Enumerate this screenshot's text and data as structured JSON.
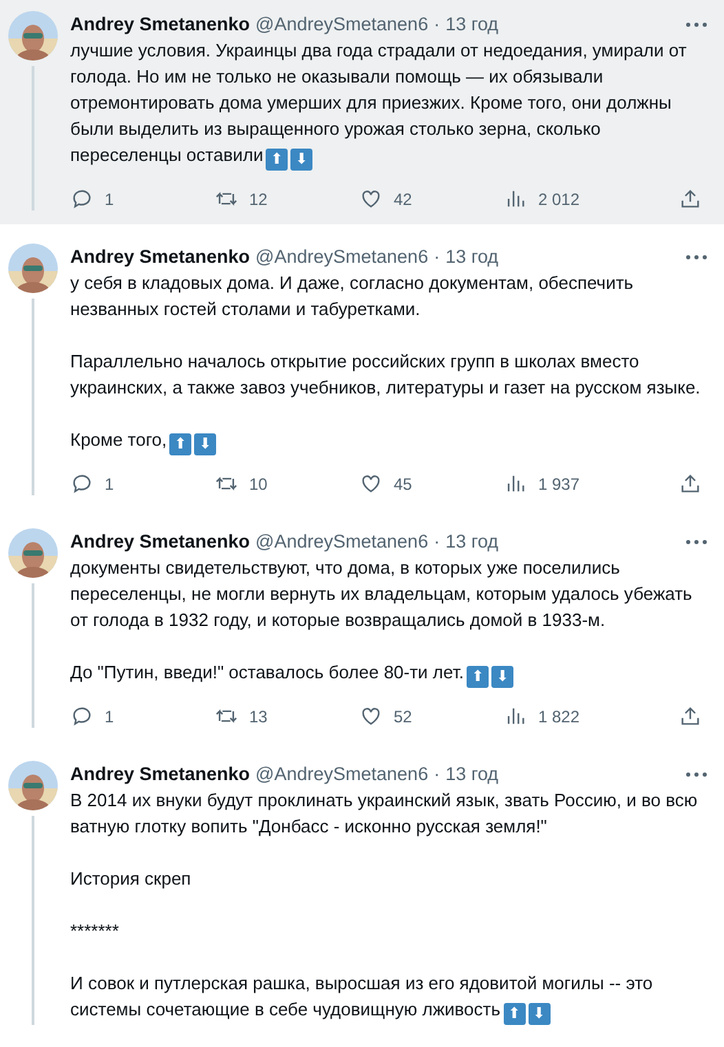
{
  "tweets": [
    {
      "author": "Andrey Smetanenko",
      "handle": "@AndreySmetanen6",
      "separator": "·",
      "time": "13 год",
      "highlighted": true,
      "paragraphs": [
        "лучшие условия. Украинцы два года страдали от недоедания, умирали от голода. Но им не только не оказывали помощь — их обязывали отремонтировать дома умерших для приезжих. Кроме того, они должны были выделить из выращенного урожая столько зерна, сколько переселенцы оставили"
      ],
      "emoji": [
        "⬆",
        "⬇"
      ],
      "replies": "1",
      "retweets": "12",
      "likes": "42",
      "views": "2 012"
    },
    {
      "author": "Andrey Smetanenko",
      "handle": "@AndreySmetanen6",
      "separator": "·",
      "time": "13 год",
      "highlighted": false,
      "paragraphs": [
        "у себя в кладовых дома. И даже, согласно документам, обеспечить незванных гостей столами и табуретками.",
        "Параллельно началось открытие российских групп в школах вместо украинских, а также завоз учебников, литературы и газет на русском языке.",
        "Кроме того,"
      ],
      "emoji": [
        "⬆",
        "⬇"
      ],
      "replies": "1",
      "retweets": "10",
      "likes": "45",
      "views": "1 937"
    },
    {
      "author": "Andrey Smetanenko",
      "handle": "@AndreySmetanen6",
      "separator": "·",
      "time": "13 год",
      "highlighted": false,
      "paragraphs": [
        "документы свидетельствуют, что дома, в которых уже поселились переселенцы, не могли вернуть их владельцам, которым удалось убежать от голода в 1932 году, и которые возвращались домой в 1933-м.",
        "До \"Путин, введи!\" оставалось более 80-ти лет."
      ],
      "emoji": [
        "⬆",
        "⬇"
      ],
      "replies": "1",
      "retweets": "13",
      "likes": "52",
      "views": "1 822"
    },
    {
      "author": "Andrey Smetanenko",
      "handle": "@AndreySmetanen6",
      "separator": "·",
      "time": "13 год",
      "highlighted": false,
      "paragraphs": [
        "В 2014 их внуки будут проклинать украинский язык, звать Россию, и во всю ватную глотку вопить \"Донбасс - исконно русская земля!\"",
        "История скреп",
        "*******",
        "И совок и путлерская рашка, выросшая из его ядовитой могилы -- это системы сочетающие в себе чудовищную лживость"
      ],
      "emoji": [
        "⬆",
        "⬇"
      ]
    }
  ]
}
